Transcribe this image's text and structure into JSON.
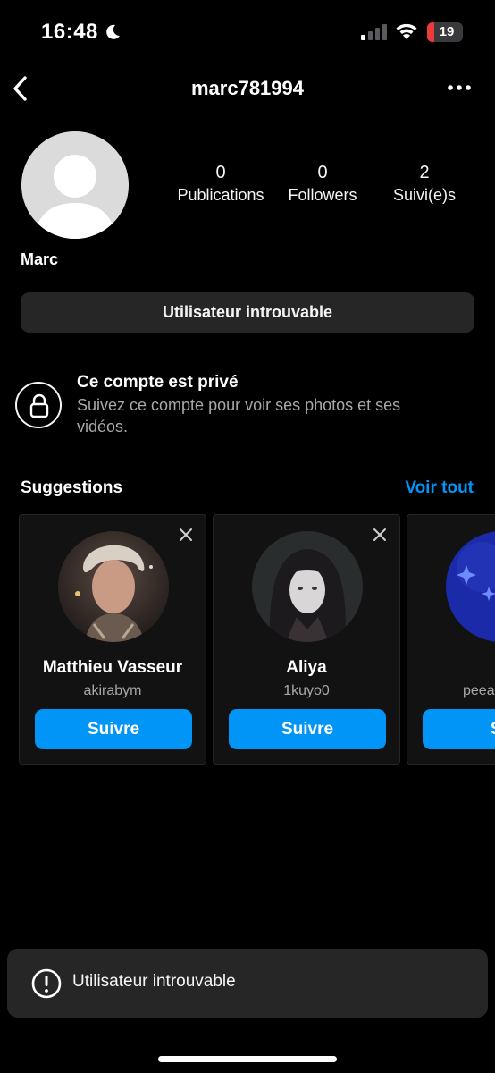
{
  "status_bar": {
    "time": "16:48",
    "battery_level": "19",
    "battery_fraction": 0.19,
    "icons": [
      "moon-icon",
      "signal-icon",
      "wifi-icon",
      "battery-icon"
    ]
  },
  "header": {
    "username": "marc781994",
    "icons": [
      "back-chevron-icon",
      "more-options-icon"
    ]
  },
  "profile": {
    "full_name": "Marc",
    "stats": [
      {
        "value": "0",
        "label": "Publications"
      },
      {
        "value": "0",
        "label": "Followers"
      },
      {
        "value": "2",
        "label": "Suivi(e)s"
      }
    ],
    "status_button_label": "Utilisateur introuvable"
  },
  "private_notice": {
    "title": "Ce compte est privé",
    "subtitle": "Suivez ce compte pour voir ses photos et ses vidéos.",
    "icon": "lock-icon"
  },
  "suggestions": {
    "title": "Suggestions",
    "see_all_label": "Voir tout",
    "cards": [
      {
        "name": "Matthieu Vasseur",
        "handle": "akirabym",
        "follow_label": "Suivre"
      },
      {
        "name": "Aliya",
        "handle": "1kuyo0",
        "follow_label": "Suivre"
      },
      {
        "name": "",
        "handle": "peea",
        "follow_label": "Su"
      }
    ]
  },
  "toast": {
    "message": "Utilisateur introuvable",
    "icon": "alert-circle-icon"
  },
  "colors": {
    "background": "#000000",
    "accent": "#0095f6",
    "secondary_text": "#a8a8a8",
    "surface": "#262626"
  }
}
